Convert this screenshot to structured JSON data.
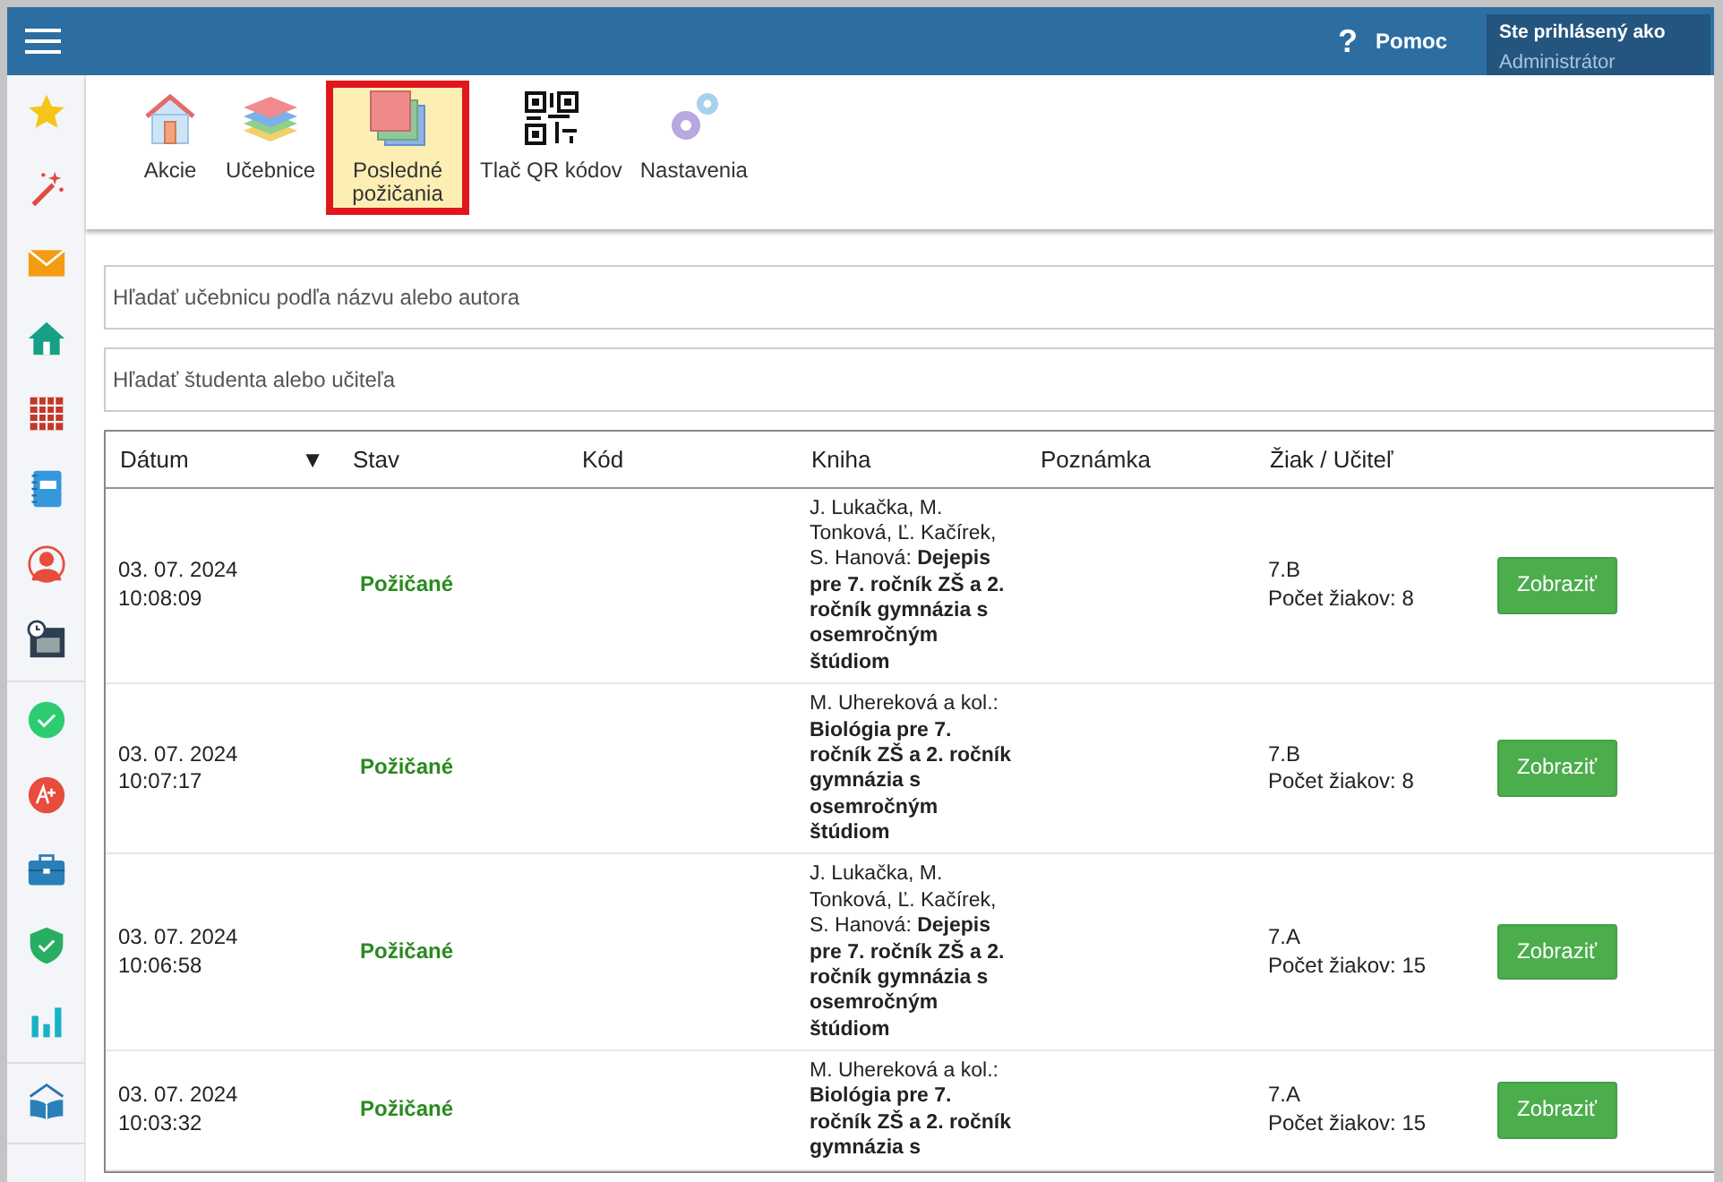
{
  "topbar": {
    "help": "Pomoc",
    "help_icon": "?",
    "user_label": "Ste prihlásený ako",
    "user_name": "Administrátor"
  },
  "toolbar": [
    {
      "label": "Akcie",
      "selected": false
    },
    {
      "label": "Učebnice",
      "selected": false
    },
    {
      "label": "Posledné požičania",
      "selected": true
    },
    {
      "label": "Tlač QR kódov",
      "selected": false
    },
    {
      "label": "Nastavenia",
      "selected": false
    }
  ],
  "search_book": {
    "placeholder": "Hľadať učebnicu podľa názvu alebo autora"
  },
  "search_person": {
    "placeholder": "Hľadať študenta alebo učiteľa"
  },
  "table": {
    "columns": [
      {
        "label": "Dátum",
        "sort": "▼"
      },
      {
        "label": "Stav"
      },
      {
        "label": "Kód"
      },
      {
        "label": "Kniha"
      },
      {
        "label": "Poznámka"
      },
      {
        "label": "Žiak / Učiteľ"
      }
    ],
    "rows": [
      {
        "date": "03. 07. 2024",
        "time": "10:08:09",
        "status": "Požičané",
        "book": "J. Lukačka, M. Tonková, Ľ. Kačírek, S. Hanová: **Dejepis pre 7. ročník ZŠ a 2. ročník gymnázia s osemročným štúdiom**",
        "class": "7.B",
        "count": "Počet žiakov: 8",
        "action": "Zobraziť"
      },
      {
        "date": "03. 07. 2024",
        "time": "10:07:17",
        "status": "Požičané",
        "book": "M. Uhereková a kol.: **Biológia pre 7. ročník ZŠ a 2. ročník gymnázia s osemročným štúdiom**",
        "class": "7.B",
        "count": "Počet žiakov: 8",
        "action": "Zobraziť"
      },
      {
        "date": "03. 07. 2024",
        "time": "10:06:58",
        "status": "Požičané",
        "book": "J. Lukačka, M. Tonková, Ľ. Kačírek, S. Hanová: **Dejepis pre 7. ročník ZŠ a 2. ročník gymnázia s osemročným štúdiom**",
        "class": "7.A",
        "count": "Počet žiakov: 15",
        "action": "Zobraziť"
      },
      {
        "date": "03. 07. 2024",
        "time": "10:03:32",
        "status": "Požičané",
        "book": "M. Uhereková a kol.: **Biológia pre 7. ročník ZŠ a 2. ročník gymnázia s**",
        "class": "7.A",
        "count": "Počet žiakov: 15",
        "action": "Zobraziť"
      }
    ]
  }
}
